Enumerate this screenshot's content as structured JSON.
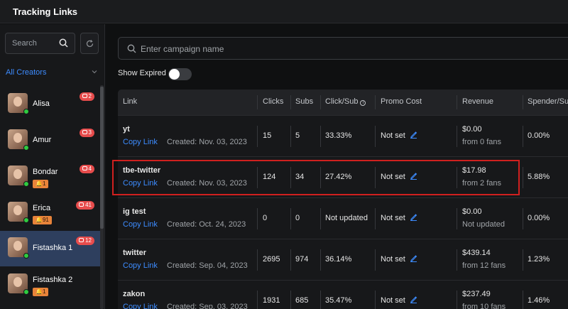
{
  "app": {
    "title": "Tracking Links"
  },
  "sidebar": {
    "search_placeholder": "Search",
    "filter_label": "All Creators",
    "creators": [
      {
        "name": "Alisa",
        "badge": "2",
        "bell": ""
      },
      {
        "name": "Amur",
        "badge": "3",
        "bell": ""
      },
      {
        "name": "Bondar",
        "badge": "4",
        "bell": "1"
      },
      {
        "name": "Erica",
        "badge": "41",
        "bell": "91"
      },
      {
        "name": "Fistashka 1",
        "badge": "12",
        "bell": ""
      },
      {
        "name": "Fistashka 2",
        "badge": "",
        "bell": "1"
      }
    ]
  },
  "main": {
    "campaign_placeholder": "Enter campaign name",
    "show_expired_label": "Show Expired",
    "show_expired": false,
    "columns": [
      "Link",
      "Clicks",
      "Subs",
      "Click/Sub",
      "Promo Cost",
      "Revenue",
      "Spender/Su"
    ],
    "copy_link_label": "Copy Link",
    "rows": [
      {
        "name": "yt",
        "created": "Created: Nov. 03, 2023",
        "clicks": "15",
        "subs": "5",
        "click_sub": "33.33%",
        "promo_cost": "Not set",
        "revenue": "$0.00",
        "revenue_sub": "from 0 fans",
        "spender": "0.00%"
      },
      {
        "name": "tbe-twitter",
        "created": "Created: Nov. 03, 2023",
        "clicks": "124",
        "subs": "34",
        "click_sub": "27.42%",
        "promo_cost": "Not set",
        "revenue": "$17.98",
        "revenue_sub": "from 2 fans",
        "spender": "5.88%"
      },
      {
        "name": "ig test",
        "created": "Created: Oct. 24, 2023",
        "clicks": "0",
        "subs": "0",
        "click_sub": "Not updated",
        "promo_cost": "Not set",
        "revenue": "$0.00",
        "revenue_sub": "Not updated",
        "spender": "0.00%"
      },
      {
        "name": "twitter",
        "created": "Created: Sep. 04, 2023",
        "clicks": "2695",
        "subs": "974",
        "click_sub": "36.14%",
        "promo_cost": "Not set",
        "revenue": "$439.14",
        "revenue_sub": "from 12 fans",
        "spender": "1.23%"
      },
      {
        "name": "zakon",
        "created": "Created: Sep. 03, 2023",
        "clicks": "1931",
        "subs": "685",
        "click_sub": "35.47%",
        "promo_cost": "Not set",
        "revenue": "$237.49",
        "revenue_sub": "from 10 fans",
        "spender": "1.46%"
      }
    ]
  },
  "colors": {
    "accent": "#3d8cff",
    "highlight": "#d0201f",
    "online": "#2ecc40",
    "badge": "#e74c4c",
    "bell_badge": "#e8833a"
  }
}
